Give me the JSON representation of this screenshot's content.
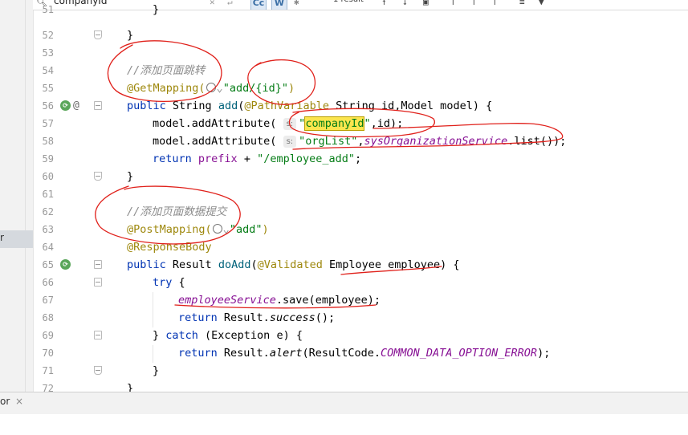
{
  "search": {
    "query": "companyId",
    "result_count": "1 result",
    "case_label": "Cc",
    "word_label": "W",
    "regex_label": "✱"
  },
  "left_panel": {
    "selected_fragment": "r"
  },
  "bottom_panel": {
    "tab_fragment": "or",
    "close": "×"
  },
  "lines": [
    {
      "n": "51"
    },
    {
      "n": "52"
    },
    {
      "n": "53"
    },
    {
      "n": "54"
    },
    {
      "n": "55"
    },
    {
      "n": "56"
    },
    {
      "n": "57"
    },
    {
      "n": "58"
    },
    {
      "n": "59"
    },
    {
      "n": "60"
    },
    {
      "n": "61"
    },
    {
      "n": "62"
    },
    {
      "n": "63"
    },
    {
      "n": "64"
    },
    {
      "n": "65"
    },
    {
      "n": "66"
    },
    {
      "n": "67"
    },
    {
      "n": "68"
    },
    {
      "n": "69"
    },
    {
      "n": "70"
    },
    {
      "n": "71"
    },
    {
      "n": "72"
    }
  ],
  "code": {
    "l51_brace": "}",
    "l52_brace": "}",
    "l54_comment": "//添加页面跳转",
    "l55_ann": "@GetMapping(",
    "l55_str": "\"add/{id}\"",
    "l55_close": ")",
    "l56_public": "public",
    "l56_sig1": " String ",
    "l56_fn": "add",
    "l56_open": "(",
    "l56_ann": "@PathVariable",
    "l56_sig2": " String id,Model model) {",
    "l57_call": "model.addAttribute(",
    "l57_hint": "s:",
    "l57_q1": "\"",
    "l57_key": "companyId",
    "l57_q2": "\"",
    "l57_rest": ",id);",
    "l58_call": "model.addAttribute(",
    "l58_hint": "s:",
    "l58_str": "\"orgList\"",
    "l58_comma": ",",
    "l58_svc": "sysOrganizationService",
    "l58_rest": ".list());",
    "l59_ret": "return",
    "l59_prefix": " prefix",
    "l59_plus": " + ",
    "l59_str": "\"/employee_add\"",
    "l59_semi": ";",
    "l60_brace": "}",
    "l62_comment": "//添加页面数据提交",
    "l63_ann": "@PostMapping(",
    "l63_str": "\"add\"",
    "l63_close": ")",
    "l64_ann": "@ResponseBody",
    "l65_public": "public",
    "l65_sig1": " Result ",
    "l65_fn": "doAdd",
    "l65_open": "(",
    "l65_ann": "@Validated",
    "l65_sig2": " Employee employee) {",
    "l66_try": "try",
    "l66_brace": " {",
    "l67_svc": "employeeService",
    "l67_rest": ".save(employee);",
    "l68_ret": "return",
    "l68_res": " Result.",
    "l68_m": "success",
    "l68_end": "();",
    "l69_close": "} ",
    "l69_catch": "catch",
    "l69_rest": " (Exception e) {",
    "l70_ret": "return",
    "l70_res": " Result.",
    "l70_m": "alert",
    "l70_mid": "(ResultCode.",
    "l70_const": "COMMON_DATA_OPTION_ERROR",
    "l70_end": ");",
    "l71_brace": "}",
    "l72_brace": "}"
  },
  "colors": {
    "keyword": "#0033b3",
    "annotation": "#9e880d",
    "string": "#067d17",
    "comment": "#8c8c8c",
    "field": "#871094",
    "search_highlight": "#fbe54e",
    "pen_annotation": "#e0201a"
  },
  "icons": {
    "search": "magnifier",
    "spring_bean": "leaf-gutter",
    "at": "@",
    "globe": "globe"
  }
}
